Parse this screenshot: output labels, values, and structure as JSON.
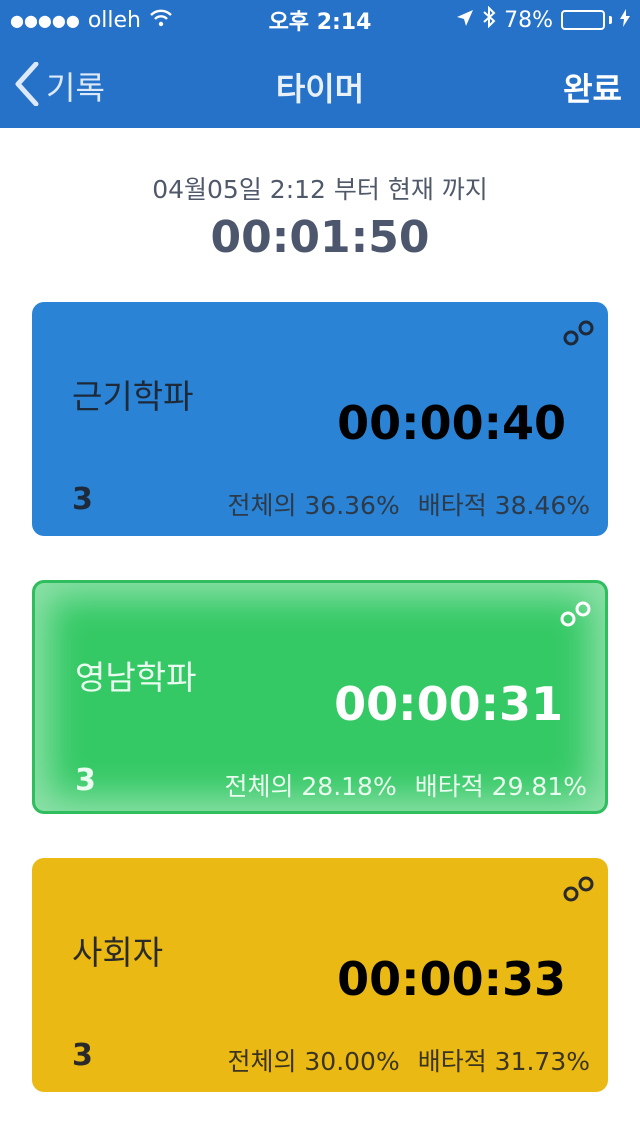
{
  "status_bar": {
    "signal": "●●●●●",
    "carrier": "olleh",
    "time": "오후 2:14",
    "battery_percent": "78%",
    "battery_level": 0.78,
    "icons": [
      "wifi-icon",
      "location-arrow-icon",
      "bluetooth-icon",
      "charging-bolt-icon"
    ]
  },
  "nav": {
    "back_label": "기록",
    "title": "타이머",
    "done_label": "완료"
  },
  "summary": {
    "range_text": "04월05일 2:12 부터 현재 까지",
    "total_time": "00:01:50"
  },
  "cards": [
    {
      "name": "근기학파",
      "time": "00:00:40",
      "count": "3",
      "overall": "전체의 36.36%",
      "exclusive": "배타적 38.46%",
      "color": "#2a83d4"
    },
    {
      "name": "영남학파",
      "time": "00:00:31",
      "count": "3",
      "overall": "전체의 28.18%",
      "exclusive": "배타적 29.81%",
      "color": "#34c965"
    },
    {
      "name": "사회자",
      "time": "00:00:33",
      "count": "3",
      "overall": "전체의 30.00%",
      "exclusive": "배타적 31.73%",
      "color": "#eab914"
    }
  ],
  "colors": {
    "nav_bg": "#2672c9",
    "battery_fill": "#4cd964"
  }
}
